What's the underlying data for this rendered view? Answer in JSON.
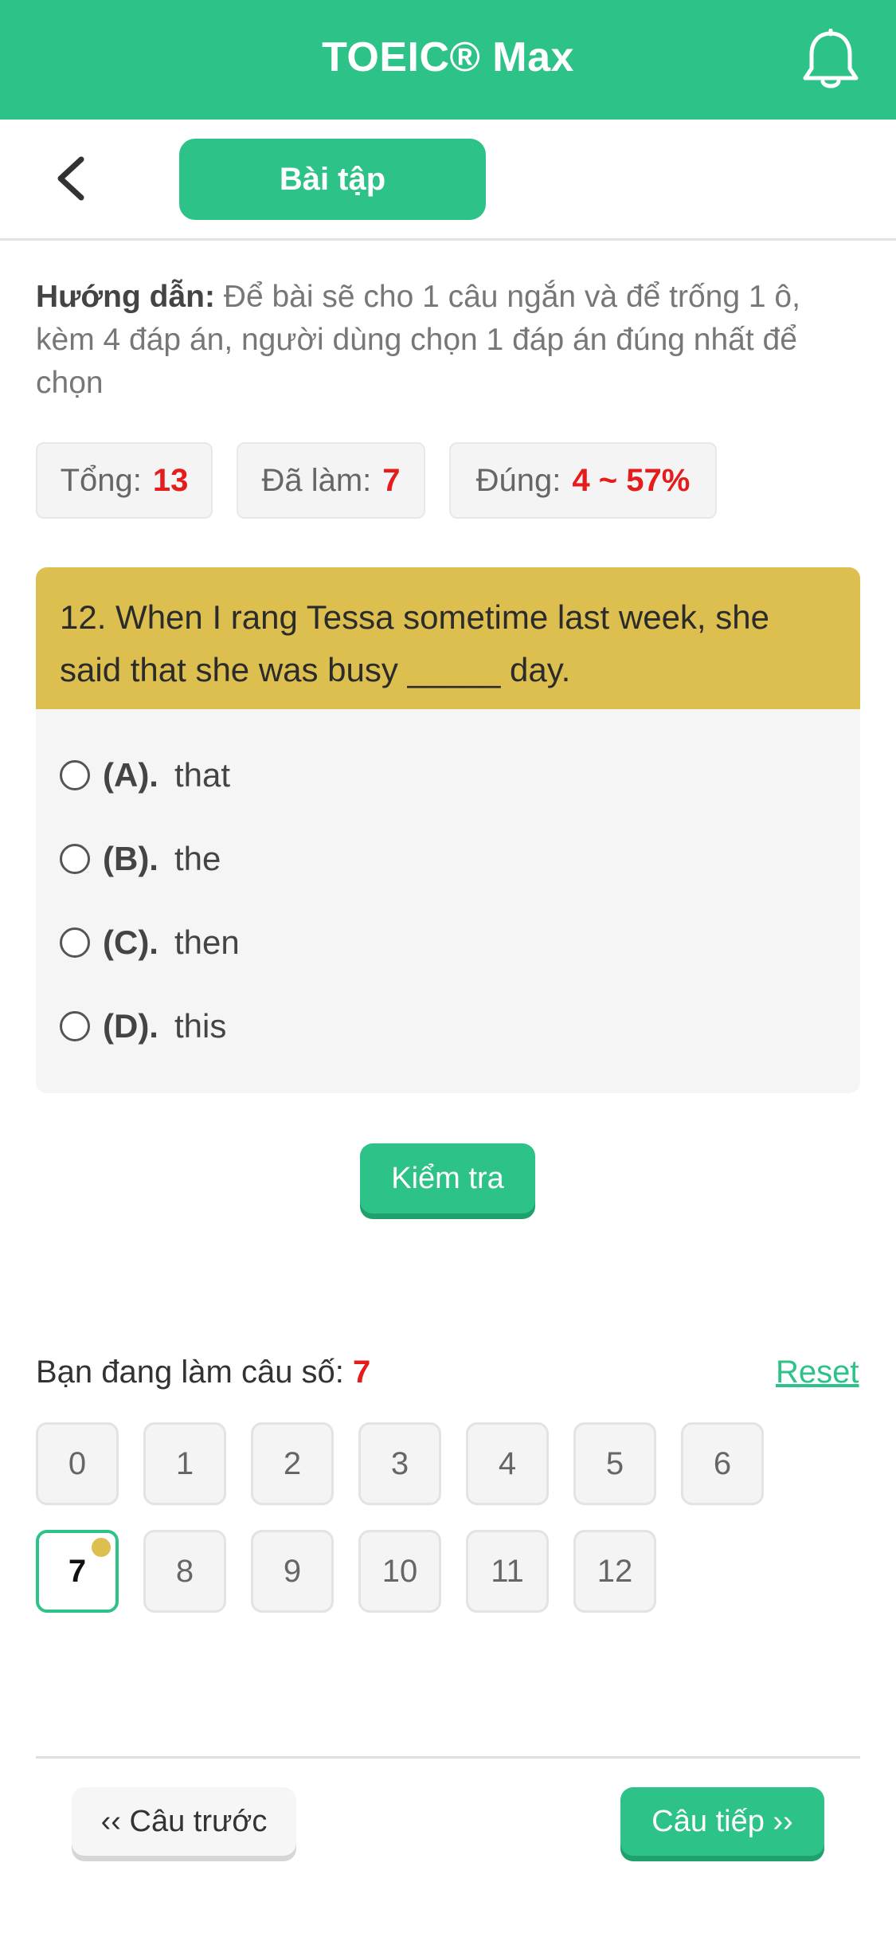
{
  "header": {
    "title": "TOEIC® Max",
    "bell_icon": "bell-icon"
  },
  "subheader": {
    "back_icon": "chevron-left-icon",
    "tab_label": "Bài tập"
  },
  "instruction": {
    "label": "Hướng dẫn:",
    "text": "Để bài sẽ cho 1 câu ngắn và để trống 1 ô, kèm 4 đáp án, người dùng chọn 1 đáp án đúng nhất để chọn"
  },
  "stats": {
    "total_label": "Tổng:",
    "total_value": "13",
    "done_label": "Đã làm:",
    "done_value": "7",
    "correct_label": "Đúng:",
    "correct_value": "4 ~ 57%"
  },
  "question": {
    "text": "12. When I rang Tessa sometime last week, she said that she was busy _____ day.",
    "options": [
      {
        "key": "(A).",
        "text": "that"
      },
      {
        "key": "(B).",
        "text": "the"
      },
      {
        "key": "(C).",
        "text": "then"
      },
      {
        "key": "(D).",
        "text": "this"
      }
    ]
  },
  "check_button": "Kiểm tra",
  "progress": {
    "label": "Bạn đang làm câu số:",
    "current": "7",
    "reset_label": "Reset",
    "numbers": [
      "0",
      "1",
      "2",
      "3",
      "4",
      "5",
      "6",
      "7",
      "8",
      "9",
      "10",
      "11",
      "12"
    ]
  },
  "footer": {
    "prev_label": "‹‹ Câu trước",
    "next_label": "Câu tiếp ››"
  },
  "colors": {
    "brand": "#2dc287",
    "question_bg": "#dcbf4e",
    "highlight": "#e41c1c"
  }
}
